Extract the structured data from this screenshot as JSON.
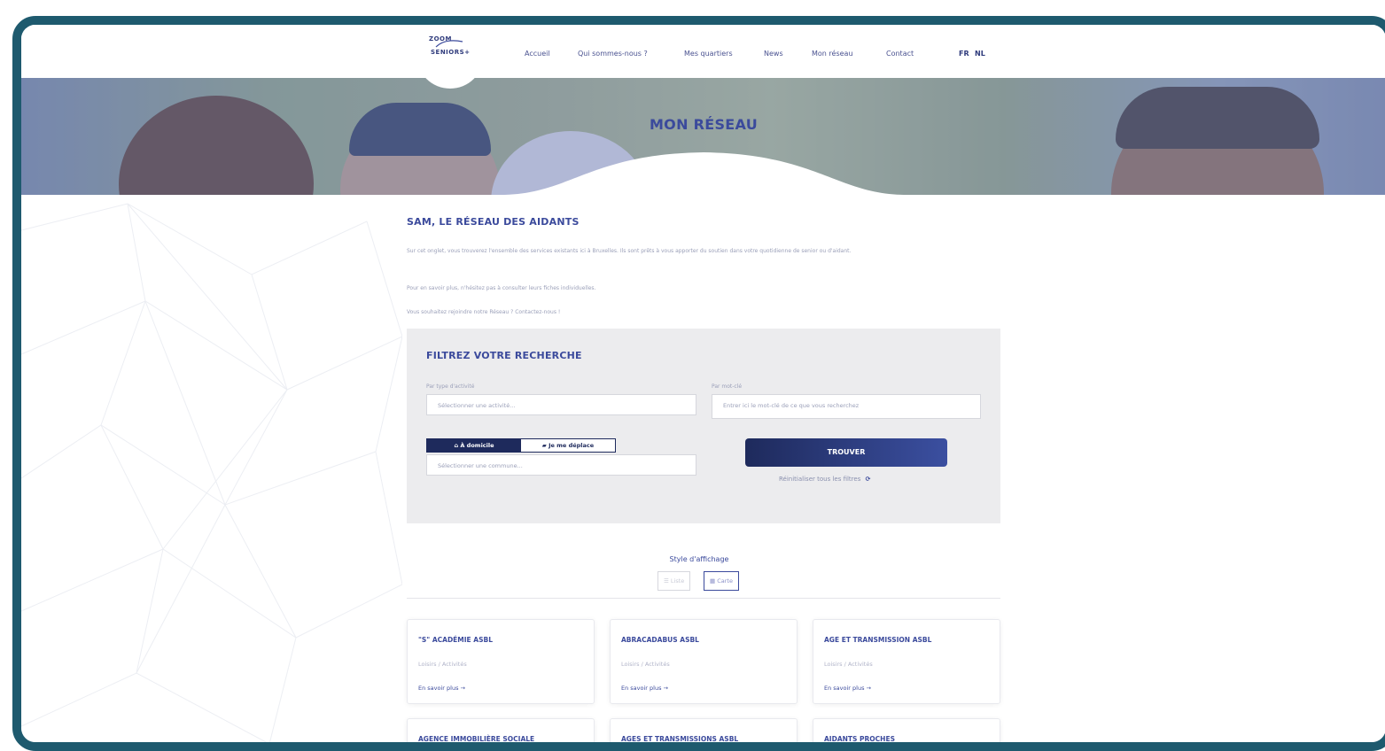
{
  "logo": {
    "line1": "ZOOM",
    "line2": "SENIORS+"
  },
  "nav": {
    "items": [
      "Accueil",
      "Qui sommes-nous ?",
      "Mes quartiers",
      "News",
      "Mon réseau",
      "Contact"
    ],
    "languages": [
      "FR",
      "NL"
    ]
  },
  "hero": {
    "title": "MON RÉSEAU"
  },
  "intro": {
    "title": "SAM, LE RÉSEAU DES AIDANTS",
    "paragraphs": [
      "Sur cet onglet, vous trouverez l'ensemble des services existants ici à Bruxelles. Ils sont prêts à vous apporter du soutien dans votre quotidienne de senior ou d'aidant.",
      "Pour en savoir plus, n'hésitez pas à consulter leurs fiches individuelles.",
      "Vous souhaitez rejoindre notre Réseau ? Contactez-nous !"
    ]
  },
  "filter": {
    "title": "FILTREZ VOTRE RECHERCHE",
    "activity_label": "Par type d'activité",
    "activity_placeholder": "Sélectionner une activité...",
    "keyword_label": "Par mot-clé",
    "keyword_placeholder": "Entrer ici le mot-clé de ce que vous recherchez",
    "toggle_home": "À domicile",
    "toggle_move": "Je me déplace",
    "commune_placeholder": "Sélectionner une commune...",
    "find_button": "TROUVER",
    "reset_label": "Réinitialiser tous les filtres"
  },
  "display": {
    "label": "Style d'affichage",
    "options": [
      "Liste",
      "Carte"
    ]
  },
  "cards": [
    {
      "title": "\"S\" ACADÉMIE ASBL",
      "category": "Loisirs / Activités",
      "more": "En savoir plus →"
    },
    {
      "title": "ABRACADABUS ASBL",
      "category": "Loisirs / Activités",
      "more": "En savoir plus →"
    },
    {
      "title": "AGE ET TRANSMISSION ASBL",
      "category": "Loisirs / Activités",
      "more": "En savoir plus →"
    },
    {
      "title": "AGENCE IMMOBILIÈRE SOCIALE",
      "category": "",
      "more": ""
    },
    {
      "title": "AGES ET TRANSMISSIONS ASBL",
      "category": "",
      "more": ""
    },
    {
      "title": "AIDANTS PROCHES",
      "category": "",
      "more": ""
    }
  ],
  "colors": {
    "frame": "#1e5a6e",
    "brand": "#3b4a9c",
    "dark_brand": "#1e2a5c"
  }
}
